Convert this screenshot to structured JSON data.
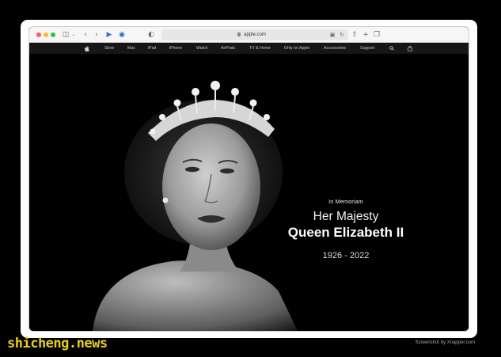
{
  "browser": {
    "url": "apple.com",
    "traffic_light_colors": [
      "#ff5f57",
      "#febc2e",
      "#28c840"
    ]
  },
  "nav": {
    "items": [
      "Store",
      "Mac",
      "iPad",
      "iPhone",
      "Watch",
      "AirPods",
      "TV & Home",
      "Only on Apple",
      "Accessories",
      "Support"
    ]
  },
  "hero": {
    "eyebrow": "In Memoriam",
    "line1": "Her Majesty",
    "line2": "Queen Elizabeth II",
    "years": "1926 - 2022"
  },
  "footer": {
    "watermark": "shicheng.news",
    "credit": "Screenshot by Xnapper.com"
  }
}
